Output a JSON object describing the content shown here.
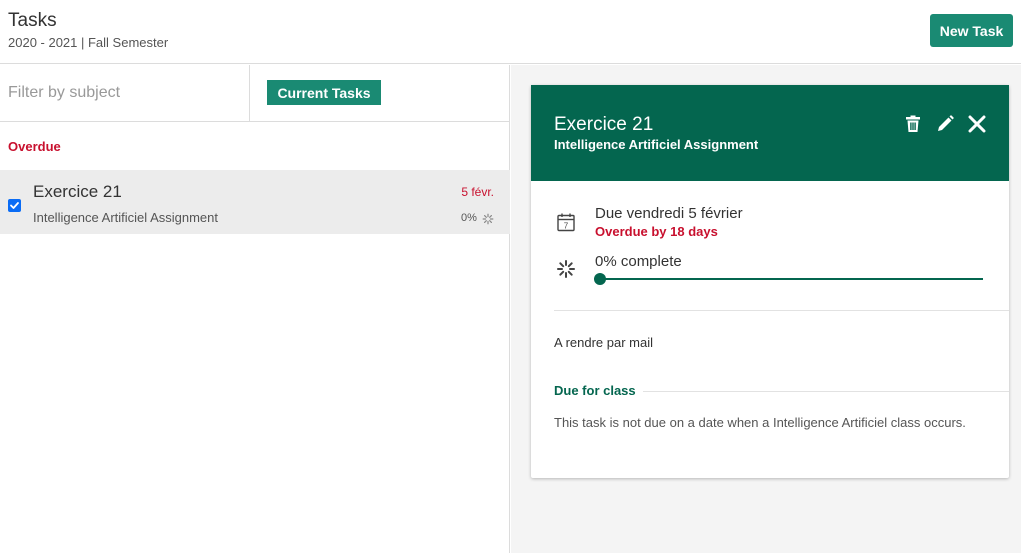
{
  "header": {
    "title": "Tasks",
    "subtitle": "2020 - 2021 | Fall Semester",
    "new_task_label": "New Task"
  },
  "filter": {
    "placeholder": "Filter by subject",
    "value": "",
    "current_tasks_label": "Current Tasks"
  },
  "task_list": {
    "group_label": "Overdue",
    "items": [
      {
        "title": "Exercice 21",
        "subtitle": "Intelligence Artificiel Assignment",
        "date": "5 févr.",
        "progress_text": "0%",
        "checked": true
      }
    ]
  },
  "detail": {
    "title": "Exercice 21",
    "subtitle": "Intelligence Artificiel Assignment",
    "due_text": "Due vendredi 5 février",
    "overdue_text": "Overdue by 18 days",
    "complete_text": "0% complete",
    "progress_value": 0,
    "calendar_day": "7",
    "note": "A rendre par mail",
    "due_for_class_label": "Due for class",
    "due_for_class_text": "This task is not due on a date when a Intelligence Artificiel class occurs."
  },
  "icons": {
    "trash": "trash-icon",
    "pencil": "pencil-icon",
    "close": "close-icon",
    "calendar": "calendar-icon",
    "spinner": "progress-spinner-icon",
    "checkbox": "checkbox-checked-icon"
  },
  "colors": {
    "accent_green": "#1a8a73",
    "detail_header_green": "#04664f",
    "overdue_red": "#c8102e",
    "checkbox_blue": "#0a6cf5",
    "selected_row_bg": "#ececec"
  }
}
